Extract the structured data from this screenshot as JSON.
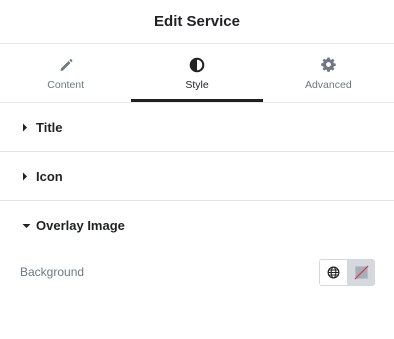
{
  "header": {
    "title": "Edit Service"
  },
  "tabs": [
    {
      "label": "Content",
      "icon": "pencil-icon",
      "active": false
    },
    {
      "label": "Style",
      "icon": "contrast-icon",
      "active": true
    },
    {
      "label": "Advanced",
      "icon": "gear-icon",
      "active": false
    }
  ],
  "sections": [
    {
      "label": "Title",
      "open": false
    },
    {
      "label": "Icon",
      "open": false
    },
    {
      "label": "Overlay Image",
      "open": true
    }
  ],
  "overlay": {
    "background_label": "Background",
    "options": [
      {
        "icon": "globe-icon",
        "selected": false
      },
      {
        "icon": "none-slash-icon",
        "selected": true
      }
    ]
  }
}
